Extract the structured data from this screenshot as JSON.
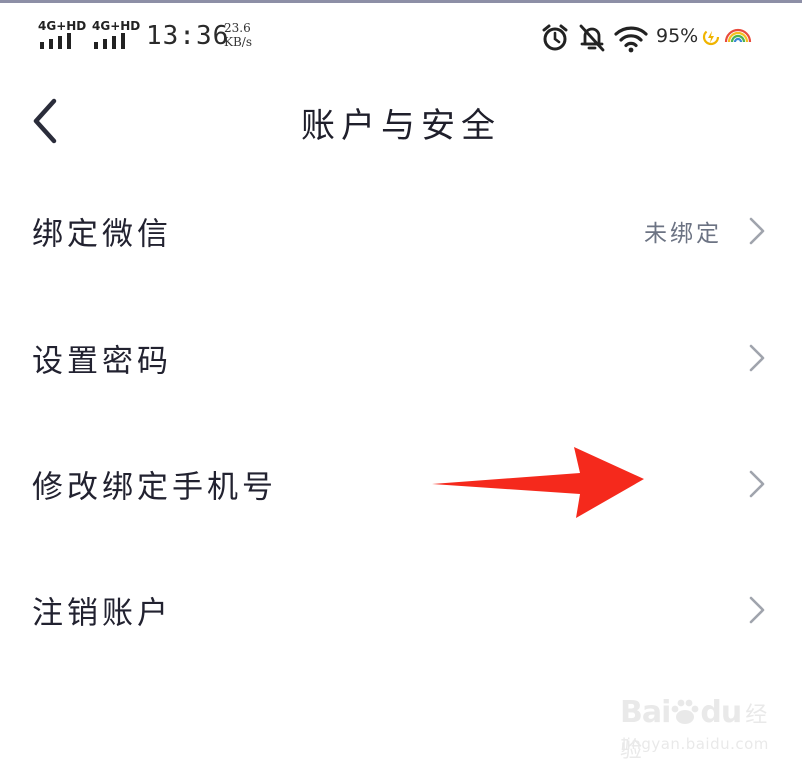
{
  "status_bar": {
    "network_1": "4G+HD",
    "network_2": "4G+HD",
    "time": "13:36",
    "speed_value": "23.6",
    "speed_unit": "KB/s",
    "battery": "95%",
    "icons": [
      "signal-icon",
      "signal-icon",
      "alarm-icon",
      "mute-bell-icon",
      "wifi-icon",
      "charging-icon",
      "rainbow-icon"
    ]
  },
  "header": {
    "title": "账户与安全",
    "back_icon": "chevron-left-icon"
  },
  "menu": {
    "items": [
      {
        "label": "绑定微信",
        "value": "未绑定"
      },
      {
        "label": "设置密码",
        "value": ""
      },
      {
        "label": "修改绑定手机号",
        "value": ""
      },
      {
        "label": "注销账户",
        "value": ""
      }
    ]
  },
  "annotation": {
    "arrow_color": "#f5291c",
    "points_to": "修改绑定手机号"
  },
  "watermark": {
    "brand": "Bai",
    "brand_tail": "du",
    "brand_cn": "经验",
    "domain": "jingyan.baidu.com"
  },
  "colors": {
    "background": "#ffffff",
    "text_primary": "#222230",
    "text_secondary": "#6c7383",
    "chevron": "#a0a4ad"
  }
}
